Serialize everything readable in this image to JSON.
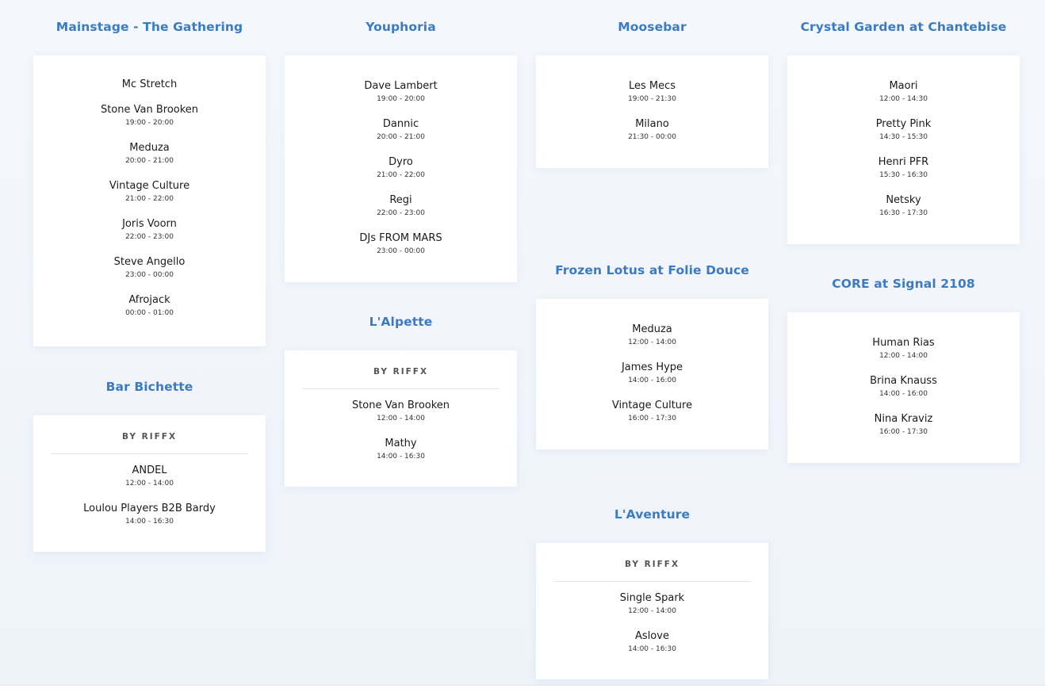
{
  "venues": [
    {
      "title": "Mainstage - The Gathering",
      "host": "",
      "acts": [
        {
          "name": "Mc Stretch",
          "time": ""
        },
        {
          "name": "Stone Van Brooken",
          "time": "19:00 - 20:00"
        },
        {
          "name": "Meduza",
          "time": "20:00 - 21:00"
        },
        {
          "name": "Vintage Culture",
          "time": "21:00 - 22:00"
        },
        {
          "name": "Joris Voorn",
          "time": "22:00 - 23:00"
        },
        {
          "name": "Steve Angello",
          "time": "23:00 - 00:00"
        },
        {
          "name": "Afrojack",
          "time": "00:00 - 01:00"
        }
      ]
    },
    {
      "title": "Bar Bichette",
      "host": "BY RIFFX",
      "acts": [
        {
          "name": "ANDEL",
          "time": "12:00 - 14:00"
        },
        {
          "name": "Loulou Players B2B Bardy",
          "time": "14:00 - 16:30"
        }
      ]
    },
    {
      "title": "Youphoria",
      "host": "",
      "acts": [
        {
          "name": "Dave Lambert",
          "time": "19:00 - 20:00"
        },
        {
          "name": "Dannic",
          "time": "20:00 - 21:00"
        },
        {
          "name": "Dyro",
          "time": "21:00 - 22:00"
        },
        {
          "name": "Regi",
          "time": "22:00 - 23:00"
        },
        {
          "name": "DJs FROM MARS",
          "time": "23:00 - 00:00"
        }
      ]
    },
    {
      "title": "L'Alpette",
      "host": "BY RIFFX",
      "acts": [
        {
          "name": "Stone Van Brooken",
          "time": "12:00 - 14:00"
        },
        {
          "name": "Mathy",
          "time": "14:00 - 16:30"
        }
      ]
    },
    {
      "title": "Moosebar",
      "host": "",
      "acts": [
        {
          "name": "Les Mecs",
          "time": "19:00 - 21:30"
        },
        {
          "name": "Milano",
          "time": "21:30 - 00:00"
        }
      ]
    },
    {
      "title": "Frozen Lotus at Folie Douce",
      "host": "",
      "acts": [
        {
          "name": "Meduza",
          "time": "12:00 - 14:00"
        },
        {
          "name": "James Hype",
          "time": "14:00 - 16:00"
        },
        {
          "name": "Vintage Culture",
          "time": "16:00 - 17:30"
        }
      ]
    },
    {
      "title": "L'Aventure",
      "host": "BY RIFFX",
      "acts": [
        {
          "name": "Single Spark",
          "time": "12:00 - 14:00"
        },
        {
          "name": "Aslove",
          "time": "14:00 - 16:30"
        }
      ]
    },
    {
      "title": "Crystal Garden at Chantebise",
      "host": "",
      "acts": [
        {
          "name": "Maori",
          "time": "12:00 - 14:30"
        },
        {
          "name": "Pretty Pink",
          "time": "14:30 - 15:30"
        },
        {
          "name": "Henri PFR",
          "time": "15:30 - 16:30"
        },
        {
          "name": "Netsky",
          "time": "16:30 - 17:30"
        }
      ]
    },
    {
      "title": "CORE at Signal 2108",
      "host": "",
      "acts": [
        {
          "name": "Human Rias",
          "time": "12:00 - 14:00"
        },
        {
          "name": "Brina Knauss",
          "time": "14:00 - 16:00"
        },
        {
          "name": "Nina Kraviz",
          "time": "16:00 - 17:30"
        }
      ]
    }
  ]
}
